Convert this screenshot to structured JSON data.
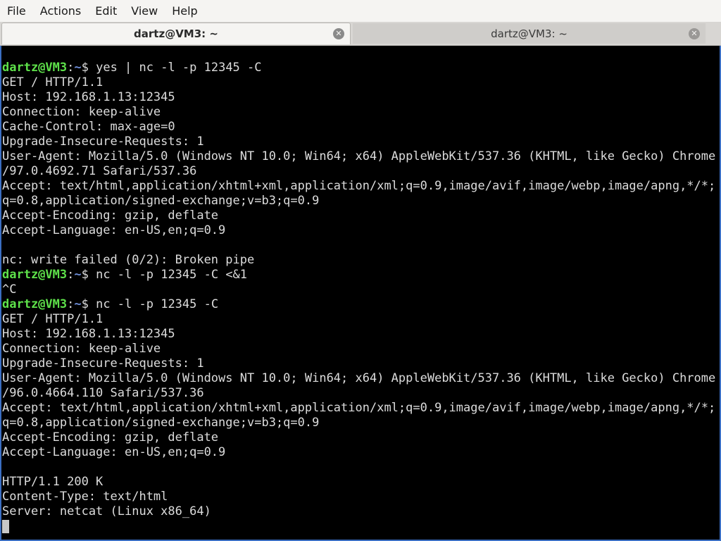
{
  "menubar": {
    "items": [
      "File",
      "Actions",
      "Edit",
      "View",
      "Help"
    ]
  },
  "tabs": [
    {
      "label": "dartz@VM3: ~",
      "active": true
    },
    {
      "label": "dartz@VM3: ~",
      "active": false
    }
  ],
  "icons": {
    "tab_close": "close-icon"
  },
  "colors": {
    "prompt_user": "#5ee14a",
    "prompt_path": "#6e8ed9",
    "terminal_bg": "#000000",
    "terminal_fg": "#dcdcdc",
    "window_border": "#3b6ec2"
  },
  "terminal": {
    "prompt": {
      "user": "dartz@VM3",
      "colon": ":",
      "path": "~",
      "symbol": "$ "
    },
    "lines": [
      {
        "type": "prompt",
        "cmd": "yes | nc -l -p 12345 -C"
      },
      {
        "type": "out",
        "text": "GET / HTTP/1.1"
      },
      {
        "type": "out",
        "text": "Host: 192.168.1.13:12345"
      },
      {
        "type": "out",
        "text": "Connection: keep-alive"
      },
      {
        "type": "out",
        "text": "Cache-Control: max-age=0"
      },
      {
        "type": "out",
        "text": "Upgrade-Insecure-Requests: 1"
      },
      {
        "type": "out",
        "text": "User-Agent: Mozilla/5.0 (Windows NT 10.0; Win64; x64) AppleWebKit/537.36 (KHTML, like Gecko) Chrome"
      },
      {
        "type": "out",
        "text": "/97.0.4692.71 Safari/537.36"
      },
      {
        "type": "out",
        "text": "Accept: text/html,application/xhtml+xml,application/xml;q=0.9,image/avif,image/webp,image/apng,*/*;"
      },
      {
        "type": "out",
        "text": "q=0.8,application/signed-exchange;v=b3;q=0.9"
      },
      {
        "type": "out",
        "text": "Accept-Encoding: gzip, deflate"
      },
      {
        "type": "out",
        "text": "Accept-Language: en-US,en;q=0.9"
      },
      {
        "type": "out",
        "text": ""
      },
      {
        "type": "out",
        "text": "nc: write failed (0/2): Broken pipe"
      },
      {
        "type": "prompt",
        "cmd": "nc -l -p 12345 -C <&1"
      },
      {
        "type": "out",
        "text": "^C"
      },
      {
        "type": "prompt",
        "cmd": "nc -l -p 12345 -C"
      },
      {
        "type": "out",
        "text": "GET / HTTP/1.1"
      },
      {
        "type": "out",
        "text": "Host: 192.168.1.13:12345"
      },
      {
        "type": "out",
        "text": "Connection: keep-alive"
      },
      {
        "type": "out",
        "text": "Upgrade-Insecure-Requests: 1"
      },
      {
        "type": "out",
        "text": "User-Agent: Mozilla/5.0 (Windows NT 10.0; Win64; x64) AppleWebKit/537.36 (KHTML, like Gecko) Chrome"
      },
      {
        "type": "out",
        "text": "/96.0.4664.110 Safari/537.36"
      },
      {
        "type": "out",
        "text": "Accept: text/html,application/xhtml+xml,application/xml;q=0.9,image/avif,image/webp,image/apng,*/*;"
      },
      {
        "type": "out",
        "text": "q=0.8,application/signed-exchange;v=b3;q=0.9"
      },
      {
        "type": "out",
        "text": "Accept-Encoding: gzip, deflate"
      },
      {
        "type": "out",
        "text": "Accept-Language: en-US,en;q=0.9"
      },
      {
        "type": "out",
        "text": ""
      },
      {
        "type": "out",
        "text": "HTTP/1.1 200 K"
      },
      {
        "type": "out",
        "text": "Content-Type: text/html"
      },
      {
        "type": "out",
        "text": "Server: netcat (Linux x86_64)"
      },
      {
        "type": "cursor"
      }
    ]
  }
}
